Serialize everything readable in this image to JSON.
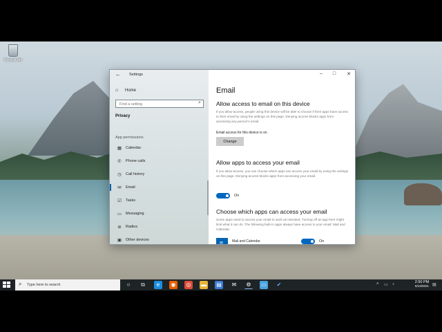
{
  "desktop": {
    "recycle_bin_label": "Recycle Bin"
  },
  "window": {
    "title": "Settings",
    "nav": {
      "home": "Home",
      "search_placeholder": "Find a setting",
      "current_section": "Privacy",
      "group_label": "App permissions",
      "items": [
        {
          "label": "Calendar",
          "icon": "calendar-icon"
        },
        {
          "label": "Phone calls",
          "icon": "phone-icon"
        },
        {
          "label": "Call history",
          "icon": "history-icon"
        },
        {
          "label": "Email",
          "icon": "mail-icon",
          "selected": true
        },
        {
          "label": "Tasks",
          "icon": "tasks-icon"
        },
        {
          "label": "Messaging",
          "icon": "message-icon"
        },
        {
          "label": "Radios",
          "icon": "radio-icon"
        },
        {
          "label": "Other devices",
          "icon": "devices-icon"
        }
      ]
    },
    "content": {
      "page_title": "Email",
      "section1": {
        "heading": "Allow access to email on this device",
        "description": "If you allow access, people using this device will be able to choose if their apps have access to their email by using the settings on this page. Denying access blocks apps from accessing any person's email.",
        "status": "Email access for this device is on",
        "button": "Change"
      },
      "section2": {
        "heading": "Allow apps to access your email",
        "description": "If you allow access, you can choose which apps can access your email by using the settings on this page. Denying access blocks apps from accessing your email.",
        "toggle_label": "On"
      },
      "section3": {
        "heading": "Choose which apps can access your email",
        "description": "Some apps need to access your email to work as intended. Turning off an app here might limit what it can do. The following built-in apps always have access to your email: Mail and Calendar.",
        "app_name": "Mail and Calendar",
        "app_toggle_label": "On"
      }
    }
  },
  "taskbar": {
    "search_placeholder": "Type here to search",
    "time": "2:50 PM",
    "date": "6/13/2021"
  }
}
